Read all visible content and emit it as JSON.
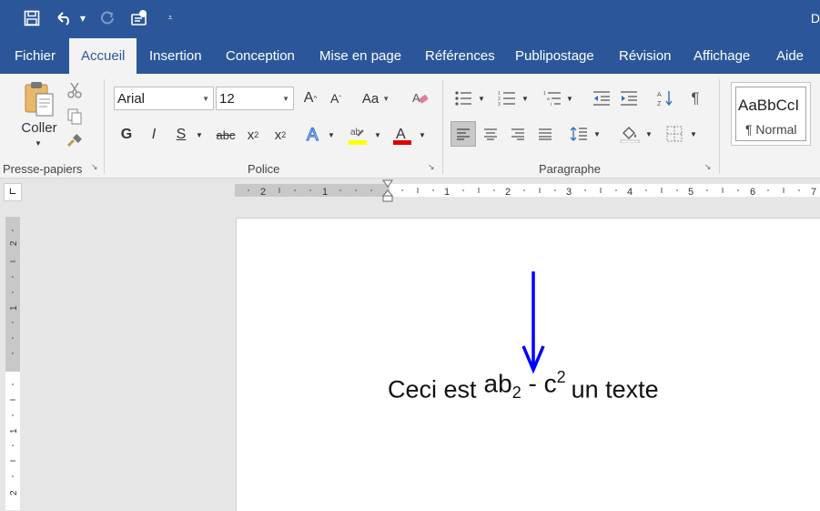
{
  "title_bar": {
    "doc_initial": "D",
    "quick_access": [
      {
        "name": "save-icon"
      },
      {
        "name": "undo-icon"
      },
      {
        "name": "redo-icon"
      },
      {
        "name": "touch-mode-icon"
      },
      {
        "name": "customize-qat-icon"
      }
    ]
  },
  "tabs": [
    "Fichier",
    "Accueil",
    "Insertion",
    "Conception",
    "Mise en page",
    "Références",
    "Publipostage",
    "Révision",
    "Affichage",
    "Aide"
  ],
  "active_tab": "Accueil",
  "ribbon": {
    "clipboard": {
      "label": "Presse-papiers",
      "paste_label": "Coller"
    },
    "font": {
      "label": "Police",
      "font_name": "Arial",
      "font_size": "12",
      "change_case": "Aa",
      "bold": "G",
      "italic": "I",
      "underline": "S",
      "strikethrough": "abc",
      "subscript_base": "x",
      "subscript_mark": "2",
      "superscript_base": "x",
      "superscript_mark": "2",
      "highlight_color": "#ffff00",
      "font_color": "#e00000"
    },
    "paragraph": {
      "label": "Paragraphe",
      "pilcrow": "¶"
    },
    "styles": {
      "preview": "AaBbCcI",
      "name": "¶ Normal"
    }
  },
  "ruler": {
    "corner": "∟",
    "left_numbers": [
      "2",
      "1"
    ],
    "right_numbers": [
      "1",
      "2",
      "3",
      "4",
      "5",
      "6",
      "7"
    ],
    "vertical_numbers": [
      "2",
      "1",
      "1",
      "2"
    ]
  },
  "document": {
    "text_before": "Ceci est",
    "formula_a": "ab",
    "formula_sub": "2",
    "formula_mid": " - c",
    "formula_sup": "2",
    "text_after": "un texte",
    "arrow_color": "#0000ff"
  },
  "colors": {
    "brand_blue": "#2b579a",
    "ribbon_bg": "#f3f3f3"
  }
}
